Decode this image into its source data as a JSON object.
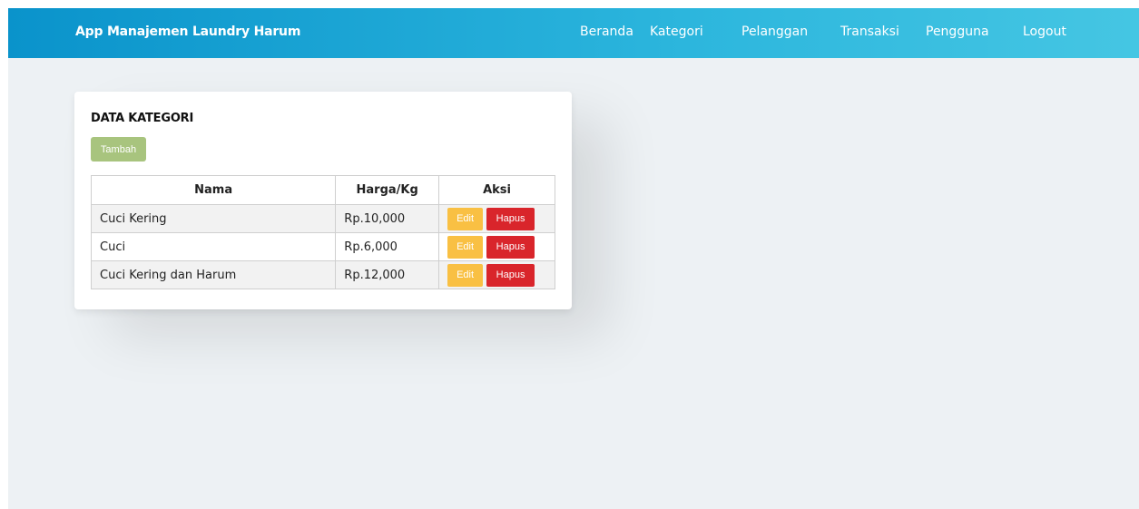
{
  "navbar": {
    "brand": "App Manajemen Laundry Harum",
    "links": [
      "Beranda",
      "Kategori",
      "Pelanggan",
      "Transaksi",
      "Pengguna",
      "Logout"
    ]
  },
  "card": {
    "title": "DATA KATEGORI",
    "add_label": "Tambah",
    "columns": [
      "Nama",
      "Harga/Kg",
      "Aksi"
    ],
    "rows": [
      {
        "name": "Cuci Kering",
        "price": "Rp.10,000",
        "edit": "Edit",
        "delete": "Hapus"
      },
      {
        "name": "Cuci",
        "price": "Rp.6,000",
        "edit": "Edit",
        "delete": "Hapus"
      },
      {
        "name": "Cuci Kering dan Harum",
        "price": "Rp.12,000",
        "edit": "Edit",
        "delete": "Hapus"
      }
    ]
  },
  "colors": {
    "navbar_start": "#0a93cb",
    "navbar_end": "#45c6e3",
    "add_button": "#a8c47e",
    "edit_button": "#f9c043",
    "delete_button": "#d9252b",
    "background": "#edf1f4"
  }
}
